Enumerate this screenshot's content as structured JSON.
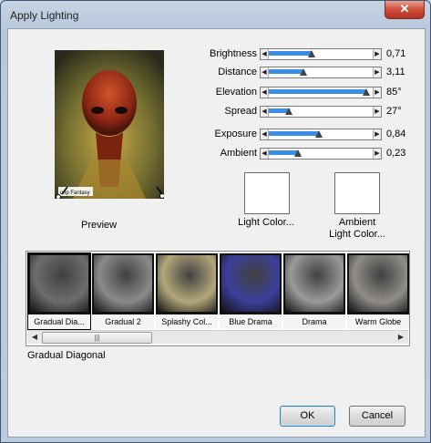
{
  "window": {
    "title": "Apply Lighting",
    "close_glyph": "✕"
  },
  "preview": {
    "label": "Preview",
    "caption_text": "cnp Fantasy"
  },
  "sliders": [
    {
      "label": "Brightness",
      "value": "0,71",
      "level": 0.41
    },
    {
      "label": "Distance",
      "value": "3,11",
      "level": 0.33
    },
    {
      "label": "Elevation",
      "value": "85°",
      "level": 0.94
    },
    {
      "label": "Spread",
      "value": "27°",
      "level": 0.19
    },
    {
      "label": "Exposure",
      "value": "0,84",
      "level": 0.48
    },
    {
      "label": "Ambient",
      "value": "0,23",
      "level": 0.28
    }
  ],
  "colors": {
    "light_color_label": "Light Color...",
    "ambient_color_label_1": "Ambient",
    "ambient_color_label_2": "Light Color..."
  },
  "presets": [
    {
      "name": "Gradual Dia...",
      "selected": true,
      "tint": "#6d6d6d"
    },
    {
      "name": "Gradual 2",
      "selected": false,
      "tint": "#8a8a8a"
    },
    {
      "name": "Splashy Col...",
      "selected": false,
      "tint": "#b3a77a"
    },
    {
      "name": "Blue Drama",
      "selected": false,
      "tint": "#3b3f9a"
    },
    {
      "name": "Drama",
      "selected": false,
      "tint": "#9a9a9a"
    },
    {
      "name": "Warm Globe",
      "selected": false,
      "tint": "#8f8d86"
    }
  ],
  "scroll": {
    "left_glyph": "◀",
    "right_glyph": "▶",
    "grip": "|||"
  },
  "selected_preset_name": "Gradual Diagonal",
  "buttons": {
    "ok": "OK",
    "cancel": "Cancel"
  },
  "accent": "#3a8ee6"
}
